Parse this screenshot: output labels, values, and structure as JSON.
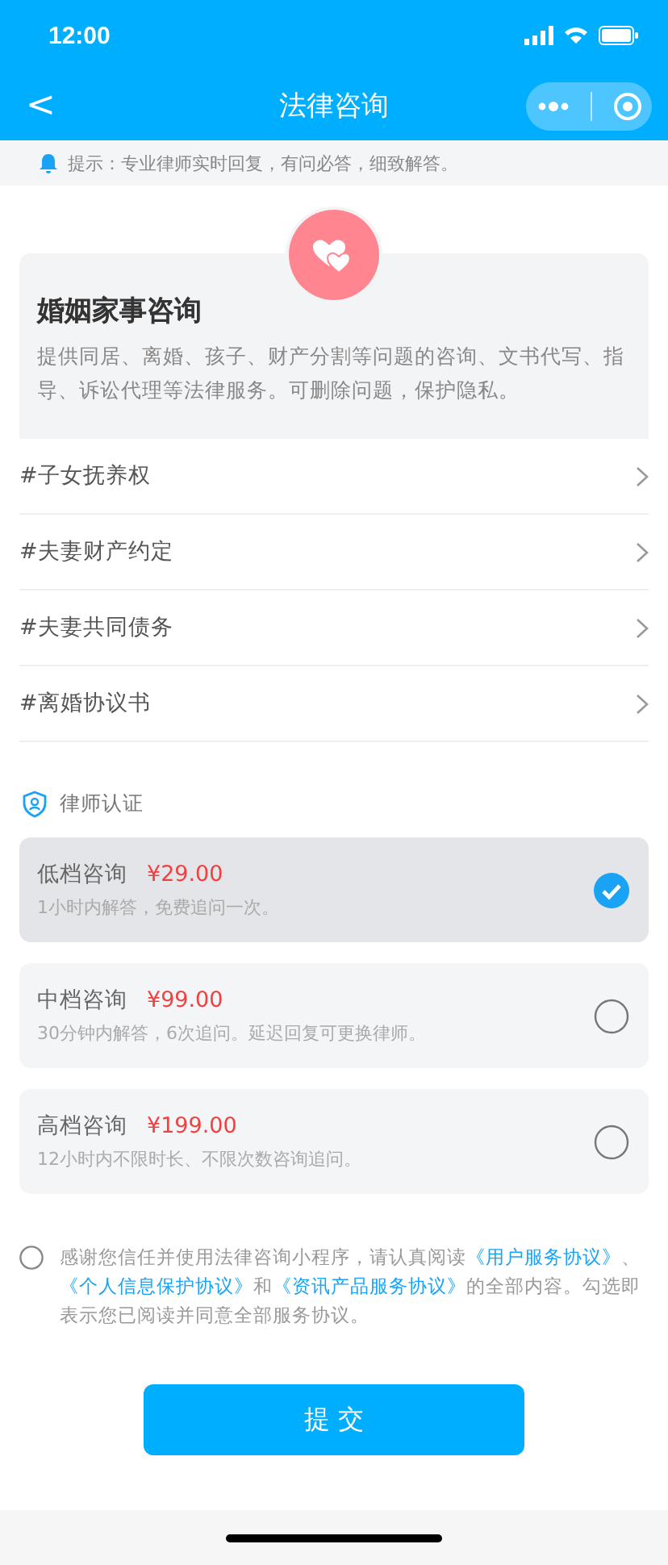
{
  "status_bar": {
    "time": "12:00"
  },
  "nav": {
    "back": "<",
    "title": "法律咨询"
  },
  "notice": {
    "text": "提示：专业律师实时回复，有问必答，细致解答。"
  },
  "category": {
    "title": "婚姻家事咨询",
    "description": "提供同居、离婚、孩子、财产分割等问题的咨询、文书代写、指导、诉讼代理等法律服务。可删除问题，保护隐私。"
  },
  "topics": [
    {
      "label": "#子女抚养权"
    },
    {
      "label": "#夫妻财产约定"
    },
    {
      "label": "#夫妻共同债务"
    },
    {
      "label": "#离婚协议书"
    }
  ],
  "certification": {
    "label": "律师认证"
  },
  "plans": [
    {
      "name": "低档咨询",
      "price": "¥29.00",
      "description": "1小时内解答，免费追问一次。",
      "selected": true
    },
    {
      "name": "中档咨询",
      "price": "¥99.00",
      "description": "30分钟内解答，6次追问。延迟回复可更换律师。",
      "selected": false
    },
    {
      "name": "高档咨询",
      "price": "¥199.00",
      "description": "12小时内不限时长、不限次数咨询追问。",
      "selected": false
    }
  ],
  "agreement": {
    "checked": false,
    "parts": [
      {
        "kind": "text",
        "text": "感谢您信任并使用法律咨询小程序，请认真阅读"
      },
      {
        "kind": "link",
        "text": "《用户服务协议》"
      },
      {
        "kind": "text",
        "text": "、"
      },
      {
        "kind": "link",
        "text": "《个人信息保护协议》"
      },
      {
        "kind": "text",
        "text": "和"
      },
      {
        "kind": "link",
        "text": "《资讯产品服务协议》"
      },
      {
        "kind": "text",
        "text": "的全部内容。勾选即表示您已阅读并同意全部服务协议。"
      }
    ]
  },
  "submit": {
    "label": "提 交"
  }
}
